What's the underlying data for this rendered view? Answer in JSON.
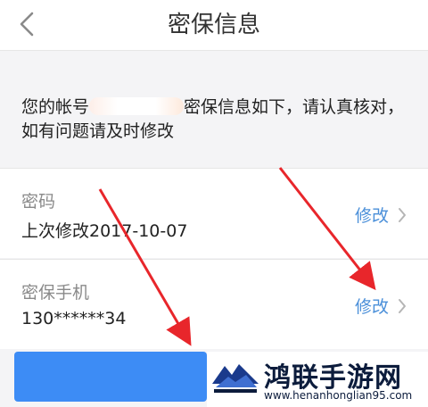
{
  "header": {
    "title": "密保信息"
  },
  "notice": {
    "prefix": "您的帐号",
    "suffix": "密保信息如下，请认真核对，如有问题请及时修改"
  },
  "rows": [
    {
      "label": "密码",
      "value": "上次修改2017-10-07",
      "action": "修改"
    },
    {
      "label": "密保手机",
      "value": "130******34",
      "action": "修改"
    }
  ],
  "watermark": {
    "brand": "鸿联手游网",
    "url": "www.henanhonglian95.com"
  },
  "colors": {
    "accent": "#4a8fd9",
    "button": "#3d8cf5",
    "arrow": "#e8262b"
  }
}
